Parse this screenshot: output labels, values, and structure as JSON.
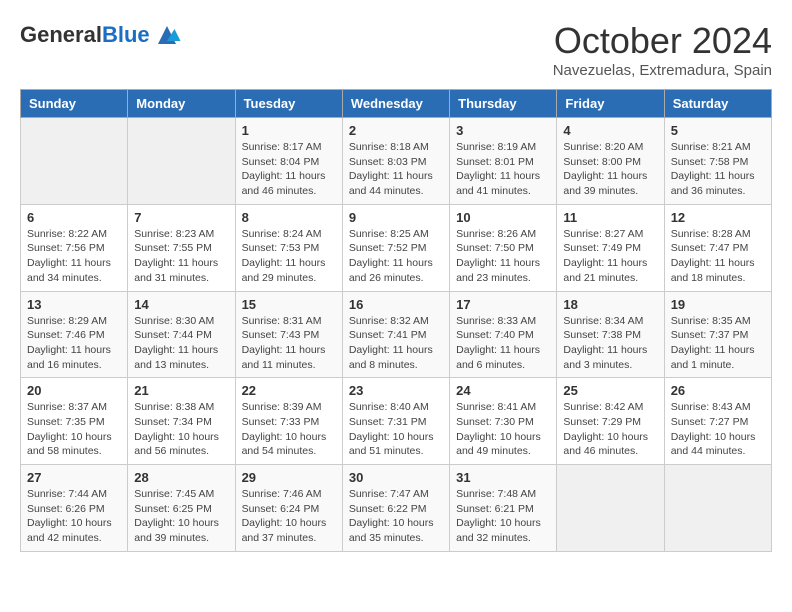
{
  "logo": {
    "general": "General",
    "blue": "Blue"
  },
  "title": "October 2024",
  "subtitle": "Navezuelas, Extremadura, Spain",
  "days_of_week": [
    "Sunday",
    "Monday",
    "Tuesday",
    "Wednesday",
    "Thursday",
    "Friday",
    "Saturday"
  ],
  "weeks": [
    [
      {
        "day": "",
        "empty": true
      },
      {
        "day": "",
        "empty": true
      },
      {
        "day": "1",
        "sunrise": "Sunrise: 8:17 AM",
        "sunset": "Sunset: 8:04 PM",
        "daylight": "Daylight: 11 hours and 46 minutes."
      },
      {
        "day": "2",
        "sunrise": "Sunrise: 8:18 AM",
        "sunset": "Sunset: 8:03 PM",
        "daylight": "Daylight: 11 hours and 44 minutes."
      },
      {
        "day": "3",
        "sunrise": "Sunrise: 8:19 AM",
        "sunset": "Sunset: 8:01 PM",
        "daylight": "Daylight: 11 hours and 41 minutes."
      },
      {
        "day": "4",
        "sunrise": "Sunrise: 8:20 AM",
        "sunset": "Sunset: 8:00 PM",
        "daylight": "Daylight: 11 hours and 39 minutes."
      },
      {
        "day": "5",
        "sunrise": "Sunrise: 8:21 AM",
        "sunset": "Sunset: 7:58 PM",
        "daylight": "Daylight: 11 hours and 36 minutes."
      }
    ],
    [
      {
        "day": "6",
        "sunrise": "Sunrise: 8:22 AM",
        "sunset": "Sunset: 7:56 PM",
        "daylight": "Daylight: 11 hours and 34 minutes."
      },
      {
        "day": "7",
        "sunrise": "Sunrise: 8:23 AM",
        "sunset": "Sunset: 7:55 PM",
        "daylight": "Daylight: 11 hours and 31 minutes."
      },
      {
        "day": "8",
        "sunrise": "Sunrise: 8:24 AM",
        "sunset": "Sunset: 7:53 PM",
        "daylight": "Daylight: 11 hours and 29 minutes."
      },
      {
        "day": "9",
        "sunrise": "Sunrise: 8:25 AM",
        "sunset": "Sunset: 7:52 PM",
        "daylight": "Daylight: 11 hours and 26 minutes."
      },
      {
        "day": "10",
        "sunrise": "Sunrise: 8:26 AM",
        "sunset": "Sunset: 7:50 PM",
        "daylight": "Daylight: 11 hours and 23 minutes."
      },
      {
        "day": "11",
        "sunrise": "Sunrise: 8:27 AM",
        "sunset": "Sunset: 7:49 PM",
        "daylight": "Daylight: 11 hours and 21 minutes."
      },
      {
        "day": "12",
        "sunrise": "Sunrise: 8:28 AM",
        "sunset": "Sunset: 7:47 PM",
        "daylight": "Daylight: 11 hours and 18 minutes."
      }
    ],
    [
      {
        "day": "13",
        "sunrise": "Sunrise: 8:29 AM",
        "sunset": "Sunset: 7:46 PM",
        "daylight": "Daylight: 11 hours and 16 minutes."
      },
      {
        "day": "14",
        "sunrise": "Sunrise: 8:30 AM",
        "sunset": "Sunset: 7:44 PM",
        "daylight": "Daylight: 11 hours and 13 minutes."
      },
      {
        "day": "15",
        "sunrise": "Sunrise: 8:31 AM",
        "sunset": "Sunset: 7:43 PM",
        "daylight": "Daylight: 11 hours and 11 minutes."
      },
      {
        "day": "16",
        "sunrise": "Sunrise: 8:32 AM",
        "sunset": "Sunset: 7:41 PM",
        "daylight": "Daylight: 11 hours and 8 minutes."
      },
      {
        "day": "17",
        "sunrise": "Sunrise: 8:33 AM",
        "sunset": "Sunset: 7:40 PM",
        "daylight": "Daylight: 11 hours and 6 minutes."
      },
      {
        "day": "18",
        "sunrise": "Sunrise: 8:34 AM",
        "sunset": "Sunset: 7:38 PM",
        "daylight": "Daylight: 11 hours and 3 minutes."
      },
      {
        "day": "19",
        "sunrise": "Sunrise: 8:35 AM",
        "sunset": "Sunset: 7:37 PM",
        "daylight": "Daylight: 11 hours and 1 minute."
      }
    ],
    [
      {
        "day": "20",
        "sunrise": "Sunrise: 8:37 AM",
        "sunset": "Sunset: 7:35 PM",
        "daylight": "Daylight: 10 hours and 58 minutes."
      },
      {
        "day": "21",
        "sunrise": "Sunrise: 8:38 AM",
        "sunset": "Sunset: 7:34 PM",
        "daylight": "Daylight: 10 hours and 56 minutes."
      },
      {
        "day": "22",
        "sunrise": "Sunrise: 8:39 AM",
        "sunset": "Sunset: 7:33 PM",
        "daylight": "Daylight: 10 hours and 54 minutes."
      },
      {
        "day": "23",
        "sunrise": "Sunrise: 8:40 AM",
        "sunset": "Sunset: 7:31 PM",
        "daylight": "Daylight: 10 hours and 51 minutes."
      },
      {
        "day": "24",
        "sunrise": "Sunrise: 8:41 AM",
        "sunset": "Sunset: 7:30 PM",
        "daylight": "Daylight: 10 hours and 49 minutes."
      },
      {
        "day": "25",
        "sunrise": "Sunrise: 8:42 AM",
        "sunset": "Sunset: 7:29 PM",
        "daylight": "Daylight: 10 hours and 46 minutes."
      },
      {
        "day": "26",
        "sunrise": "Sunrise: 8:43 AM",
        "sunset": "Sunset: 7:27 PM",
        "daylight": "Daylight: 10 hours and 44 minutes."
      }
    ],
    [
      {
        "day": "27",
        "sunrise": "Sunrise: 7:44 AM",
        "sunset": "Sunset: 6:26 PM",
        "daylight": "Daylight: 10 hours and 42 minutes."
      },
      {
        "day": "28",
        "sunrise": "Sunrise: 7:45 AM",
        "sunset": "Sunset: 6:25 PM",
        "daylight": "Daylight: 10 hours and 39 minutes."
      },
      {
        "day": "29",
        "sunrise": "Sunrise: 7:46 AM",
        "sunset": "Sunset: 6:24 PM",
        "daylight": "Daylight: 10 hours and 37 minutes."
      },
      {
        "day": "30",
        "sunrise": "Sunrise: 7:47 AM",
        "sunset": "Sunset: 6:22 PM",
        "daylight": "Daylight: 10 hours and 35 minutes."
      },
      {
        "day": "31",
        "sunrise": "Sunrise: 7:48 AM",
        "sunset": "Sunset: 6:21 PM",
        "daylight": "Daylight: 10 hours and 32 minutes."
      },
      {
        "day": "",
        "empty": true
      },
      {
        "day": "",
        "empty": true
      }
    ]
  ]
}
